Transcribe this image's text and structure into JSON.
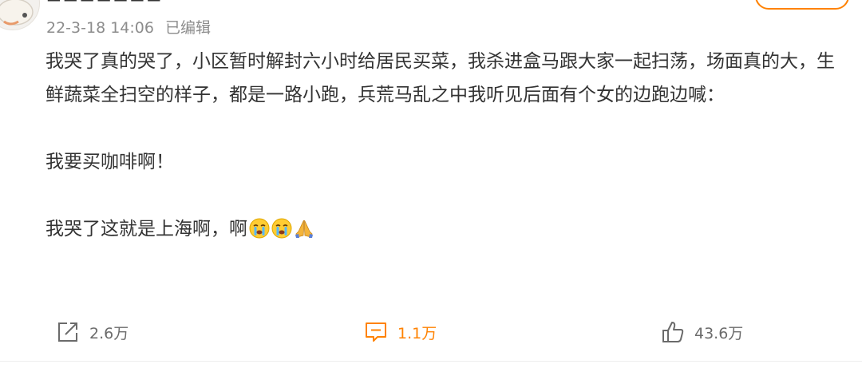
{
  "post": {
    "meta": {
      "datetime": "22-3-18 14:06",
      "edited": "已编辑"
    },
    "content": {
      "paragraph1": "我哭了真的哭了，小区暂时解封六小时给居民买菜，我杀进盒马跟大家一起扫荡，场面真的大，生鲜蔬菜全扫空的样子，都是一路小跑，兵荒马乱之中我听见后面有个女的边跑边喊：",
      "paragraph2": "我要买咖啡啊！",
      "paragraph3": "我哭了这就是上海啊，啊"
    },
    "emojis": [
      "crying-face-emoji",
      "crying-face-emoji",
      "praying-hands-emoji"
    ],
    "actions": {
      "forward": {
        "icon": "share-icon",
        "count": "2.6万"
      },
      "comment": {
        "icon": "comment-icon",
        "count": "1.1万"
      },
      "like": {
        "icon": "thumbs-up-icon",
        "count": "43.6万"
      }
    },
    "colors": {
      "accent": "#ff8200",
      "text": "#333333",
      "meta": "#8c8c8c"
    }
  }
}
